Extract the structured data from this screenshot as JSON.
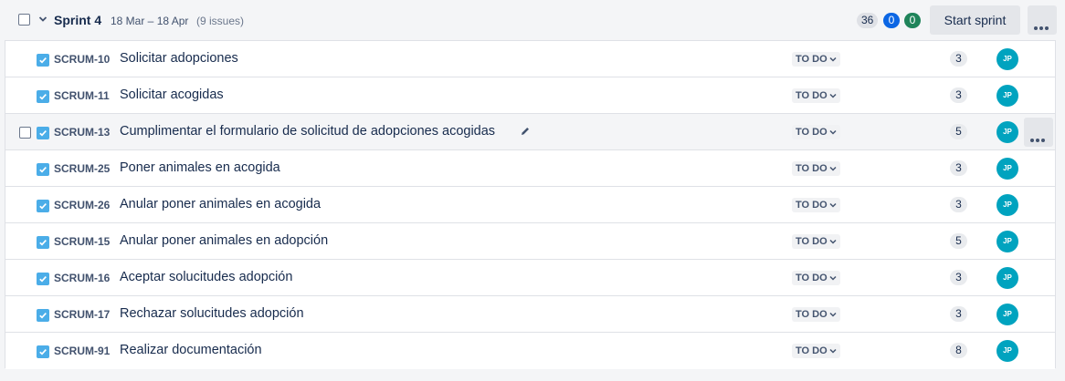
{
  "sprint": {
    "name": "Sprint 4",
    "dates": "18 Mar – 18 Apr",
    "issue_count": "(9 issues)",
    "points_todo": "36",
    "points_in_progress": "0",
    "points_done": "0",
    "start_label": "Start sprint",
    "more_icon": "more-horizontal-icon",
    "collapse_icon": "chevron-down-icon"
  },
  "issues": [
    {
      "key": "SCRUM-10",
      "summary": "Solicitar adopciones",
      "status": "TO DO",
      "points": "3",
      "assignee": "JP"
    },
    {
      "key": "SCRUM-11",
      "summary": "Solicitar acogidas",
      "status": "TO DO",
      "points": "3",
      "assignee": "JP"
    },
    {
      "key": "SCRUM-13",
      "summary": "Cumplimentar el formulario de solicitud de adopciones acogidas",
      "status": "TO DO",
      "points": "5",
      "assignee": "JP"
    },
    {
      "key": "SCRUM-25",
      "summary": "Poner animales en acogida",
      "status": "TO DO",
      "points": "3",
      "assignee": "JP"
    },
    {
      "key": "SCRUM-26",
      "summary": "Anular poner animales en acogida",
      "status": "TO DO",
      "points": "3",
      "assignee": "JP"
    },
    {
      "key": "SCRUM-15",
      "summary": "Anular poner animales en adopción",
      "status": "TO DO",
      "points": "5",
      "assignee": "JP"
    },
    {
      "key": "SCRUM-16",
      "summary": "Aceptar solucitudes adopción",
      "status": "TO DO",
      "points": "3",
      "assignee": "JP"
    },
    {
      "key": "SCRUM-17",
      "summary": "Rechazar solucitudes adopción",
      "status": "TO DO",
      "points": "3",
      "assignee": "JP"
    },
    {
      "key": "SCRUM-91",
      "summary": "Realizar documentación",
      "status": "TO DO",
      "points": "8",
      "assignee": "JP"
    }
  ],
  "colors": {
    "task_icon": "#4bade8",
    "avatar": "#00a3bf",
    "pill_blue": "#0c66e4",
    "pill_green": "#1f845a"
  }
}
